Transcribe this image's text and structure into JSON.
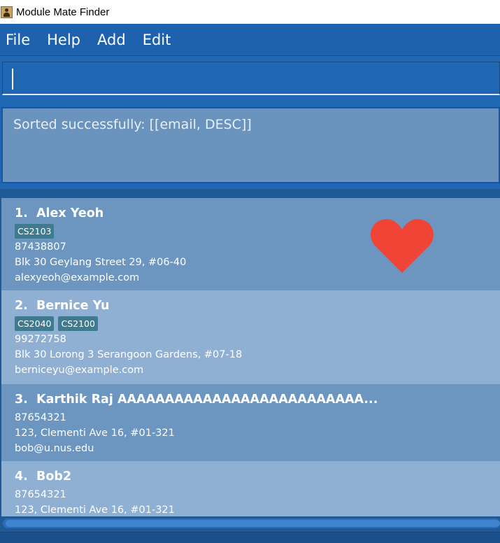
{
  "window": {
    "title": "Module Mate Finder"
  },
  "menu": [
    "File",
    "Help",
    "Add",
    "Edit"
  ],
  "command": {
    "value": ""
  },
  "result": {
    "text": "Sorted successfully: [[email, DESC]]"
  },
  "persons": [
    {
      "index": "1.",
      "name": "Alex Yeoh",
      "tags": [
        "CS2103"
      ],
      "phone": "87438807",
      "address": "Blk 30 Geylang Street 29, #06-40",
      "email": "alexyeoh@example.com",
      "favourite": true
    },
    {
      "index": "2.",
      "name": "Bernice Yu",
      "tags": [
        "CS2040",
        "CS2100"
      ],
      "phone": "99272758",
      "address": "Blk 30 Lorong 3 Serangoon Gardens, #07-18",
      "email": "berniceyu@example.com",
      "favourite": false
    },
    {
      "index": "3.",
      "name": "Karthik Raj AAAAAAAAAAAAAAAAAAAAAAAAAA...",
      "tags": [],
      "phone": "87654321",
      "address": "123, Clementi Ave 16, #01-321",
      "email": "bob@u.nus.edu",
      "favourite": false
    },
    {
      "index": "4.",
      "name": "Bob2",
      "tags": [],
      "phone": "87654321",
      "address": "123, Clementi Ave 16, #01-321",
      "email": "",
      "favourite": false
    }
  ],
  "colors": {
    "menubar": "#1e62ad",
    "favourite_heart": "#f04536",
    "tag": "#3e7b91"
  },
  "icons": {
    "app": "address-book-icon",
    "favourite": "heart-icon"
  }
}
